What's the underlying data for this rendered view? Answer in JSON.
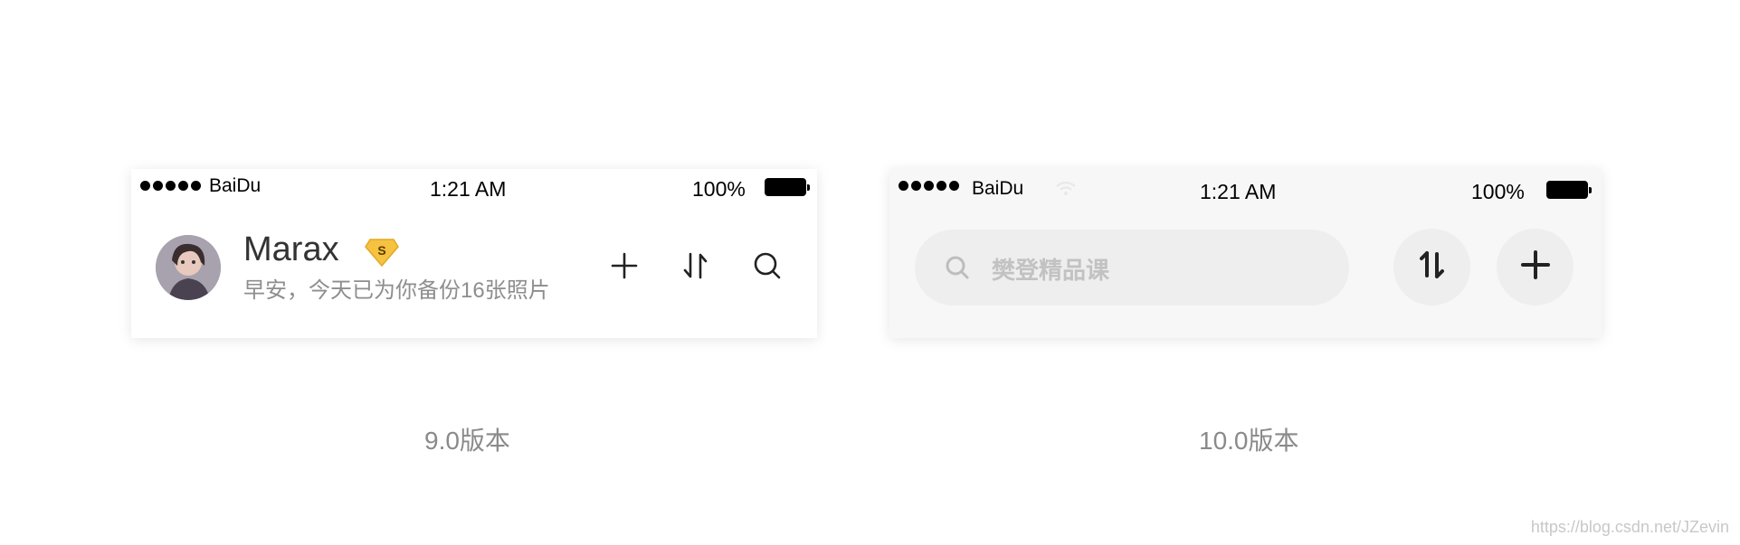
{
  "v9": {
    "status": {
      "carrier": "BaiDu",
      "time": "1:21 AM",
      "battery": "100%"
    },
    "user": {
      "name": "Marax",
      "badge": "S",
      "greeting": "早安，今天已为你备份16张照片"
    },
    "icons": [
      "avatar",
      "vip-badge-icon",
      "add-icon",
      "transfer-icon",
      "search-icon"
    ],
    "caption": "9.0版本"
  },
  "v10": {
    "status": {
      "carrier": "BaiDu",
      "time": "1:21 AM",
      "battery": "100%"
    },
    "search": {
      "placeholder": "樊登精品课"
    },
    "icons": [
      "search-icon",
      "transfer-icon",
      "add-icon",
      "wifi-icon"
    ],
    "caption": "10.0版本"
  },
  "watermark": "https://blog.csdn.net/JZevin",
  "colors": {
    "card_v9_bg": "#ffffff",
    "card_v10_bg": "#f7f7f7",
    "badge_gold": "#f5c242",
    "text_gray": "#8e8e8e"
  }
}
